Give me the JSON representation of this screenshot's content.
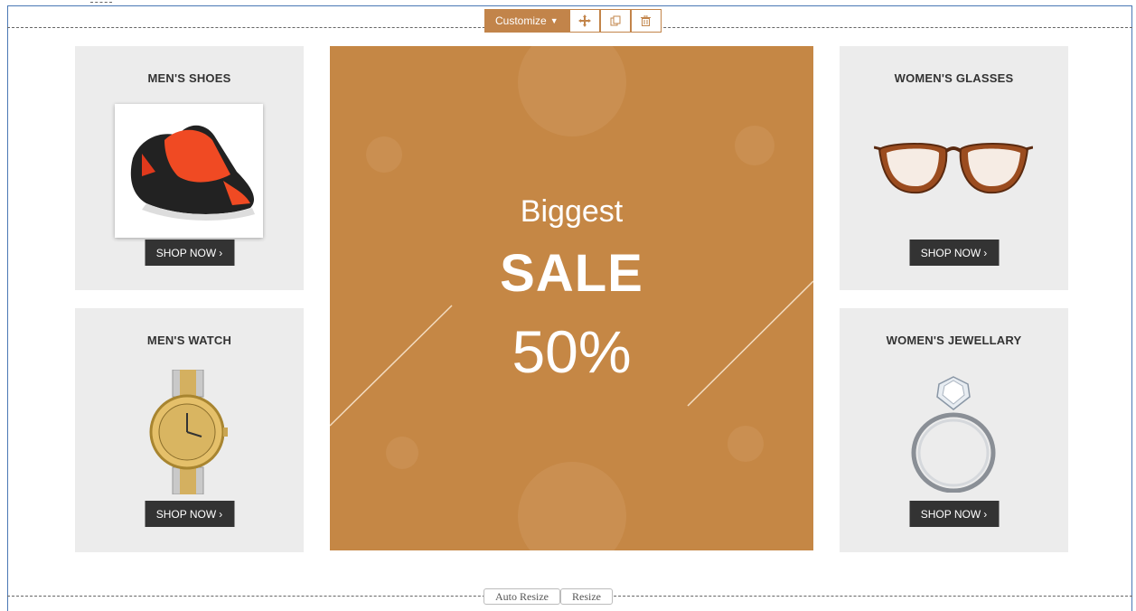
{
  "toolbar": {
    "customize_label": "Customize",
    "icons": [
      "move-icon",
      "copy-icon",
      "trash-icon"
    ]
  },
  "panels": {
    "mens_shoes": {
      "title": "MEN'S SHOES",
      "button": "SHOP NOW"
    },
    "mens_watch": {
      "title": "MEN'S WATCH",
      "button": "SHOP NOW"
    },
    "womens_glasses": {
      "title": "WOMEN'S GLASSES",
      "button": "SHOP NOW"
    },
    "womens_jewellary": {
      "title": "WOMEN'S JEWELLARY",
      "button": "SHOP NOW"
    }
  },
  "banner": {
    "line1": "Biggest",
    "line2": "SALE",
    "line3": "50%",
    "color": "#c58745"
  },
  "resize": {
    "auto_label": "Auto Resize",
    "resize_label": "Resize"
  },
  "colors": {
    "accent": "#c2844a",
    "frame": "#4a78b5",
    "button": "#333333",
    "panel_bg": "#ececec"
  }
}
